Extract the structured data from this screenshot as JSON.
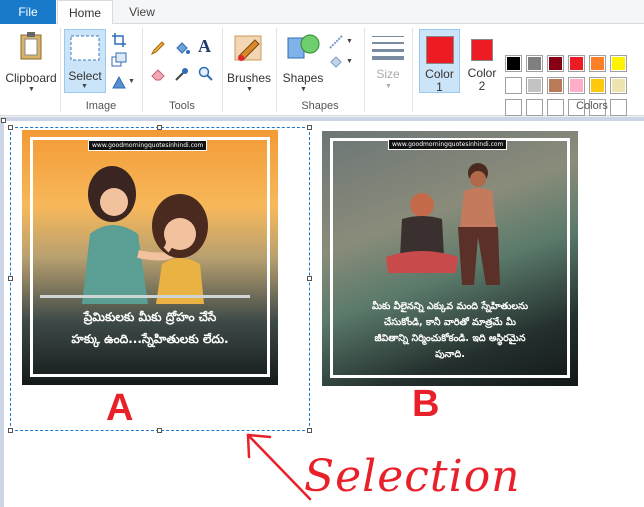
{
  "tabs": {
    "file": "File",
    "home": "Home",
    "view": "View"
  },
  "image_group": {
    "label": "Image",
    "select": "Select"
  },
  "clipboard": {
    "label": "Clipboard"
  },
  "tools_group": {
    "label": "Tools"
  },
  "brushes": {
    "label": "Brushes"
  },
  "shapes_group": {
    "shapes": "Shapes",
    "label": "Shapes"
  },
  "size": {
    "label": "Size"
  },
  "colors_group": {
    "color1": "Color",
    "color1_num": "1",
    "color2": "Color",
    "color2_num": "2",
    "label": "Colors",
    "color1_value": "#ed1c24",
    "color2_value": "#ed1c24",
    "palette_row1": [
      "#000000",
      "#7f7f7f",
      "#880015",
      "#ed1c24",
      "#ff7f27",
      "#fff200"
    ],
    "palette_row2": [
      "#ffffff",
      "#c3c3c3",
      "#b97a57",
      "#ffaec9",
      "#ffc90e",
      "#efe4b0"
    ]
  },
  "canvas": {
    "image_a": {
      "url_tag": "www.goodmorningquotesinhindi.com",
      "quote_line1": "ప్రేమికులకు మీకు ద్రోహం చేసే",
      "quote_line2": "హక్కు ఉంది...స్నేహితులకు లేదు."
    },
    "image_b": {
      "url_tag": "www.goodmorningquotesinhindi.com",
      "quote_line1": "మీకు వీలైనన్ని ఎక్కువ మంది స్నేహితులను",
      "quote_line2": "చేసుకోండి, కానీ వారితో మాత్రమే మీ",
      "quote_line3": "జీవితాన్ని నిర్మించుకోకండి. ఇది అస్థిరమైన",
      "quote_line4": "పునాది."
    },
    "label_a": "A",
    "label_b": "B",
    "annotation": "Selection"
  }
}
